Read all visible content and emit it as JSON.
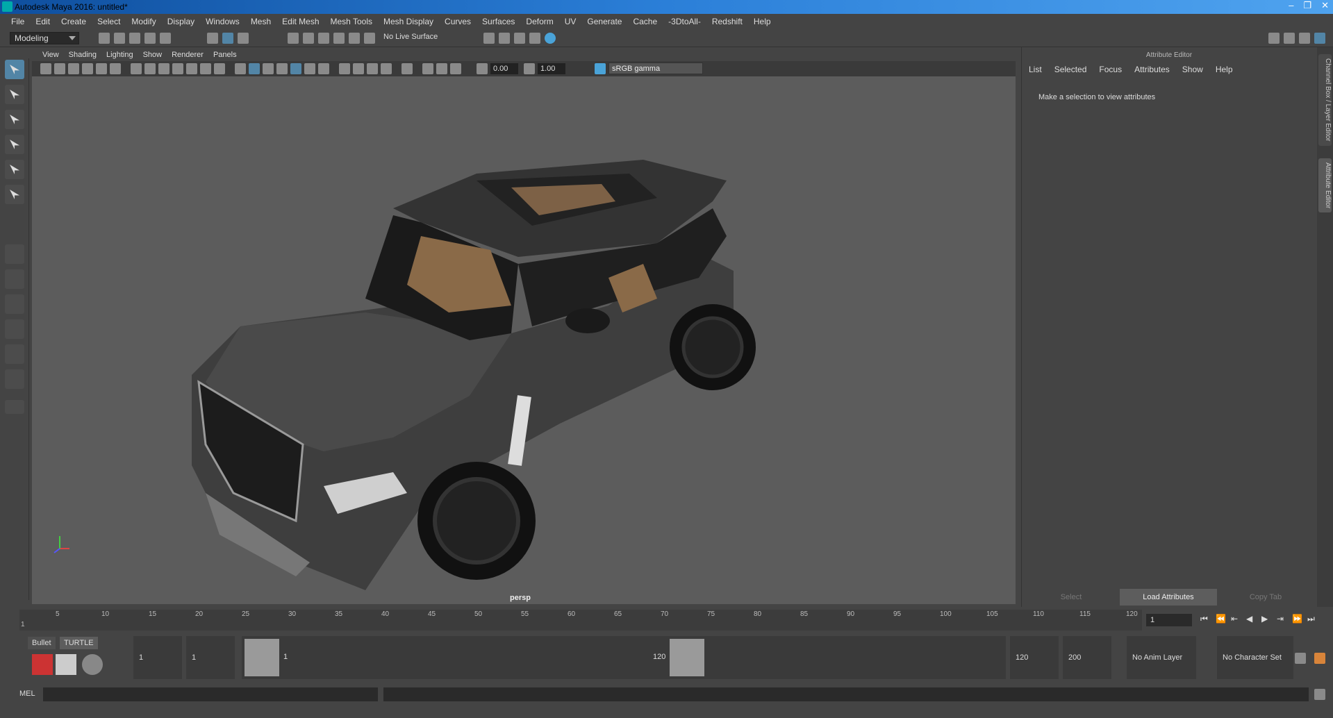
{
  "window": {
    "title": "Autodesk Maya 2016: untitled*",
    "controls": [
      "–",
      "❐",
      "✕"
    ]
  },
  "menubar": [
    "File",
    "Edit",
    "Create",
    "Select",
    "Modify",
    "Display",
    "Windows",
    "Mesh",
    "Edit Mesh",
    "Mesh Tools",
    "Mesh Display",
    "Curves",
    "Surfaces",
    "Deform",
    "UV",
    "Generate",
    "Cache",
    "-3DtoAll-",
    "Redshift",
    "Help"
  ],
  "status_line": {
    "mode": "Modeling",
    "live_surface": "No Live Surface"
  },
  "viewport": {
    "menu": [
      "View",
      "Shading",
      "Lighting",
      "Show",
      "Renderer",
      "Panels"
    ],
    "exposure": "0.00",
    "gamma_value": "1.00",
    "color_space": "sRGB gamma",
    "camera_label": "persp"
  },
  "attribute_editor": {
    "title": "Attribute Editor",
    "menu": [
      "List",
      "Selected",
      "Focus",
      "Attributes",
      "Show",
      "Help"
    ],
    "message": "Make a selection to view attributes",
    "buttons": [
      "Select",
      "Load Attributes",
      "Copy Tab"
    ]
  },
  "side_tabs": [
    "Channel Box / Layer Editor",
    "Attribute Editor"
  ],
  "timeline": {
    "ticks": [
      "1",
      "5",
      "10",
      "15",
      "20",
      "25",
      "30",
      "35",
      "40",
      "45",
      "50",
      "55",
      "60",
      "65",
      "70",
      "75",
      "80",
      "85",
      "90",
      "95",
      "100",
      "105",
      "110",
      "115",
      "120"
    ],
    "current_frame": "1"
  },
  "shelf_tabs": [
    "Bullet",
    "TURTLE"
  ],
  "range": {
    "start": "1",
    "playback_start": "1",
    "slider_start": "1",
    "slider_end": "120",
    "playback_end": "120",
    "end": "200",
    "anim_layer": "No Anim Layer",
    "character_set": "No Character Set"
  },
  "command_line": {
    "label": "MEL"
  }
}
